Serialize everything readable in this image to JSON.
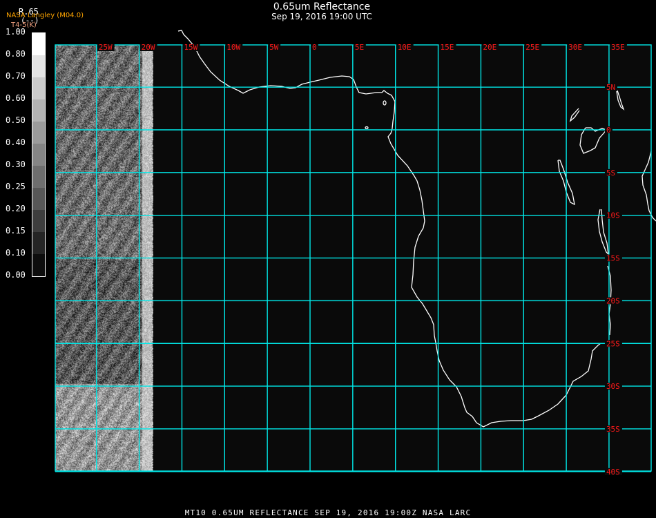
{
  "header": {
    "title": "0.65um Reflectance",
    "subtitle": "Sep 19, 2016 19:00 UTC",
    "product": "R.65",
    "units": "(--)",
    "organization": "NASA Langley (M04.0)",
    "secondary_product": "T4-5(K)"
  },
  "colorbar": {
    "labels": [
      "1.00",
      "0.80",
      "0.70",
      "0.60",
      "0.50",
      "0.40",
      "0.30",
      "0.25",
      "0.20",
      "0.15",
      "0.10",
      "0.00"
    ],
    "colors": [
      "#ffffff",
      "#e4e4e4",
      "#cbcbcb",
      "#b3b3b3",
      "#9b9b9b",
      "#858585",
      "#6e6e6e",
      "#575757",
      "#3e3e3e",
      "#252525",
      "#0d0d0d"
    ]
  },
  "map": {
    "grid_color": "#00e8e8",
    "label_color": "#ff1a1a",
    "coast_color": "#ffffff",
    "longitudes": [
      {
        "value": -25,
        "label": "25W"
      },
      {
        "value": -20,
        "label": "20W"
      },
      {
        "value": -15,
        "label": "15W"
      },
      {
        "value": -10,
        "label": "10W"
      },
      {
        "value": -5,
        "label": "5W"
      },
      {
        "value": 0,
        "label": "0"
      },
      {
        "value": 5,
        "label": "5E"
      },
      {
        "value": 10,
        "label": "10E"
      },
      {
        "value": 15,
        "label": "15E"
      },
      {
        "value": 20,
        "label": "20E"
      },
      {
        "value": 25,
        "label": "25E"
      },
      {
        "value": 30,
        "label": "30E"
      },
      {
        "value": 35,
        "label": "35E"
      }
    ],
    "latitudes": [
      {
        "value": 5,
        "label": "5N"
      },
      {
        "value": 0,
        "label": "0"
      },
      {
        "value": -5,
        "label": "5S"
      },
      {
        "value": -10,
        "label": "10S"
      },
      {
        "value": -15,
        "label": "15S"
      },
      {
        "value": -20,
        "label": "20S"
      },
      {
        "value": -25,
        "label": "25S"
      },
      {
        "value": -30,
        "label": "30S"
      },
      {
        "value": -35,
        "label": "35S"
      },
      {
        "value": -40,
        "label": "40S"
      }
    ]
  },
  "footer": {
    "text": "MT10  0.65UM REFLECTANCE   SEP 19, 2016 19:00Z   NASA LARC"
  }
}
